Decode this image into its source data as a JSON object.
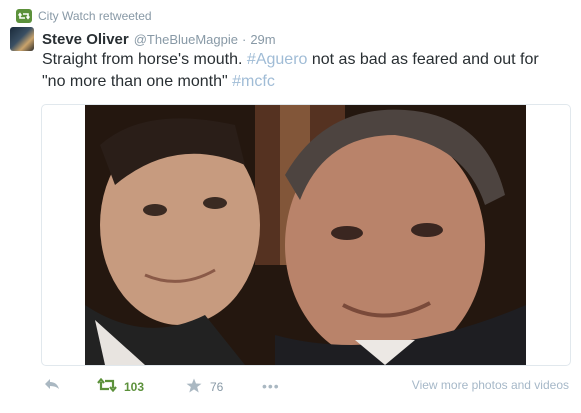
{
  "retweet": {
    "label": "City Watch retweeted",
    "icon": "retweet-icon"
  },
  "author": {
    "name": "Steve Oliver",
    "handle": "@TheBlueMagpie",
    "separator": "·",
    "time": "29m"
  },
  "tweet": {
    "text_part1": "Straight from horse's mouth. ",
    "hashtag1": "#Aguero",
    "text_part2": " not as bad as feared and out for \"no more than one month\" ",
    "hashtag2": "#mcfc"
  },
  "actions": {
    "retweet_count": "103",
    "favorite_count": "76",
    "more": "•••",
    "view_more": "View more photos and videos"
  },
  "colors": {
    "retweet_green": "#5c913b",
    "hashtag": "#a0bcd6",
    "meta_gray": "#8899a6"
  }
}
